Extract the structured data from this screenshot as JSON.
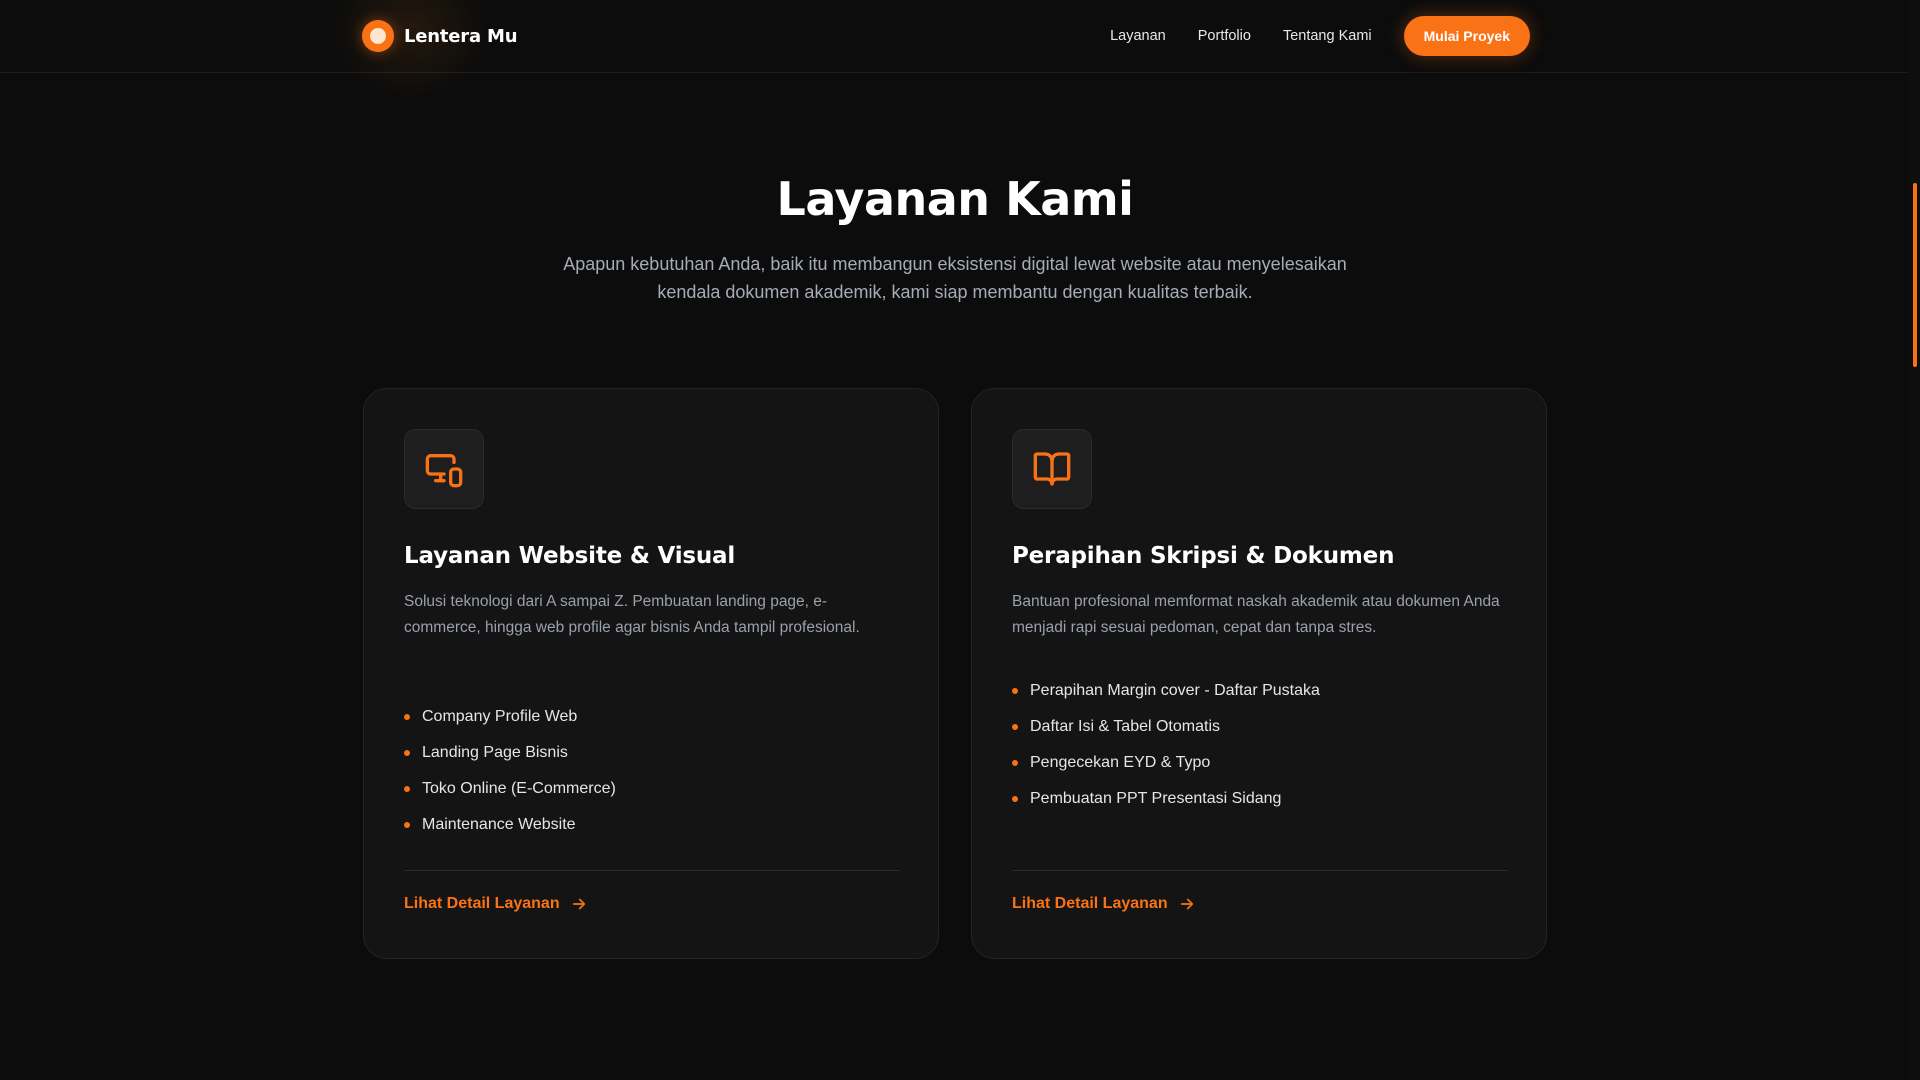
{
  "colors": {
    "accent": "#f97316",
    "background": "#0c0c0c",
    "card_background": "#141414",
    "muted_text": "#9aa1ab"
  },
  "navbar": {
    "brand_name": "Lentera Mu",
    "brand_icon": "sun-logo-icon",
    "links": [
      "Layanan",
      "Portfolio",
      "Tentang Kami"
    ],
    "cta_label": "Mulai Proyek"
  },
  "section": {
    "title": "Layanan Kami",
    "subtitle": "Apapun kebutuhan Anda, baik itu membangun eksistensi digital lewat website atau menyelesaikan kendala dokumen akademik, kami siap membantu dengan kualitas terbaik."
  },
  "cards": [
    {
      "icon": "devices-icon",
      "title": "Layanan Website & Visual",
      "description": "Solusi teknologi dari A sampai Z. Pembuatan landing page, e-commerce, hingga web profile agar bisnis Anda tampil profesional.",
      "items": [
        "Company Profile Web",
        "Landing Page Bisnis",
        "Toko Online (E-Commerce)",
        "Maintenance Website"
      ],
      "link_label": "Lihat Detail Layanan",
      "link_icon": "arrow-right-icon"
    },
    {
      "icon": "open-book-icon",
      "title": "Perapihan Skripsi & Dokumen",
      "description": "Bantuan profesional memformat naskah akademik atau dokumen Anda menjadi rapi sesuai pedoman, cepat dan tanpa stres.",
      "items": [
        "Perapihan Margin cover - Daftar Pustaka",
        "Daftar Isi & Tabel Otomatis",
        "Pengecekan EYD & Typo",
        "Pembuatan PPT Presentasi Sidang"
      ],
      "link_label": "Lihat Detail Layanan",
      "link_icon": "arrow-right-icon"
    }
  ]
}
